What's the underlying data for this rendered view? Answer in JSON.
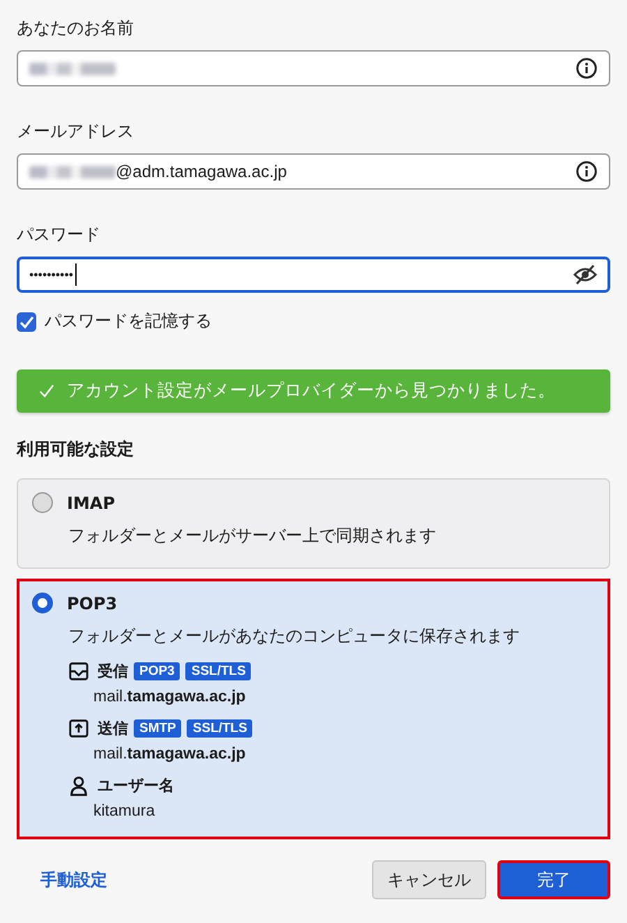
{
  "fields": [
    {
      "label": "あなたのお名前",
      "kind": "info",
      "redacted": true,
      "focused": false
    },
    {
      "label": "メールアドレス",
      "kind": "info",
      "redacted": true,
      "value": "@adm.tamagawa.ac.jp",
      "focused": false
    },
    {
      "label": "パスワード",
      "kind": "password",
      "redacted": false,
      "value": "••••••••••",
      "focused": true
    }
  ],
  "remember": {
    "label": "パスワードを記憶する",
    "checked": true
  },
  "banner": {
    "text": "アカウント設定がメールプロバイダーから見つかりました。"
  },
  "section_title": "利用可能な設定",
  "options": [
    {
      "title": "IMAP",
      "description": "フォルダーとメールがサーバー上で同期されます",
      "selected": false,
      "highlighted": false
    },
    {
      "title": "POP3",
      "description": "フォルダーとメールがあなたのコンピュータに保存されます",
      "selected": true,
      "highlighted": true,
      "details": [
        {
          "kind": "incoming",
          "label": "受信",
          "tags": [
            "POP3",
            "SSL/TLS"
          ],
          "value": "mail.**tamagawa.ac.jp**"
        },
        {
          "kind": "outgoing",
          "label": "送信",
          "tags": [
            "SMTP",
            "SSL/TLS"
          ],
          "value": "mail.**tamagawa.ac.jp**"
        },
        {
          "kind": "user",
          "label": "ユーザー名",
          "value": "kitamura"
        }
      ]
    }
  ],
  "footer": {
    "manual_link": "手動設定",
    "cancel": "キャンセル",
    "done": "完了",
    "done_highlighted": true
  }
}
